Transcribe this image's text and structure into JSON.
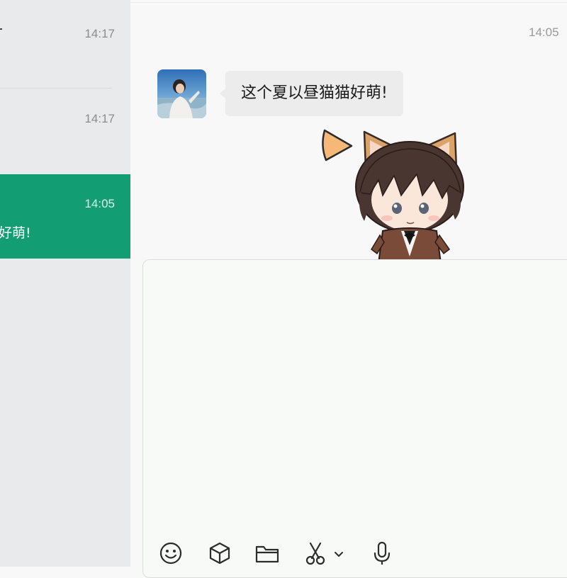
{
  "conversation_list": [
    {
      "time": "14:17"
    },
    {
      "time": "14:17"
    },
    {
      "time": "14:05",
      "preview": "好萌!",
      "selected": true
    }
  ],
  "chat": {
    "timestamp": "14:05",
    "message": {
      "text": "这个夏以昼猫猫好萌!"
    },
    "sticker": {
      "description": "cat-ear chibi sticker"
    }
  },
  "toolbar": {
    "icons": [
      "emoji-icon",
      "sticker-box-icon",
      "folder-icon",
      "scissors-icon",
      "chevron-down-icon",
      "microphone-icon"
    ]
  },
  "colors": {
    "selected_conversation": "#129e72",
    "sidebar": "#e9eaec",
    "bubble": "#ececec"
  }
}
